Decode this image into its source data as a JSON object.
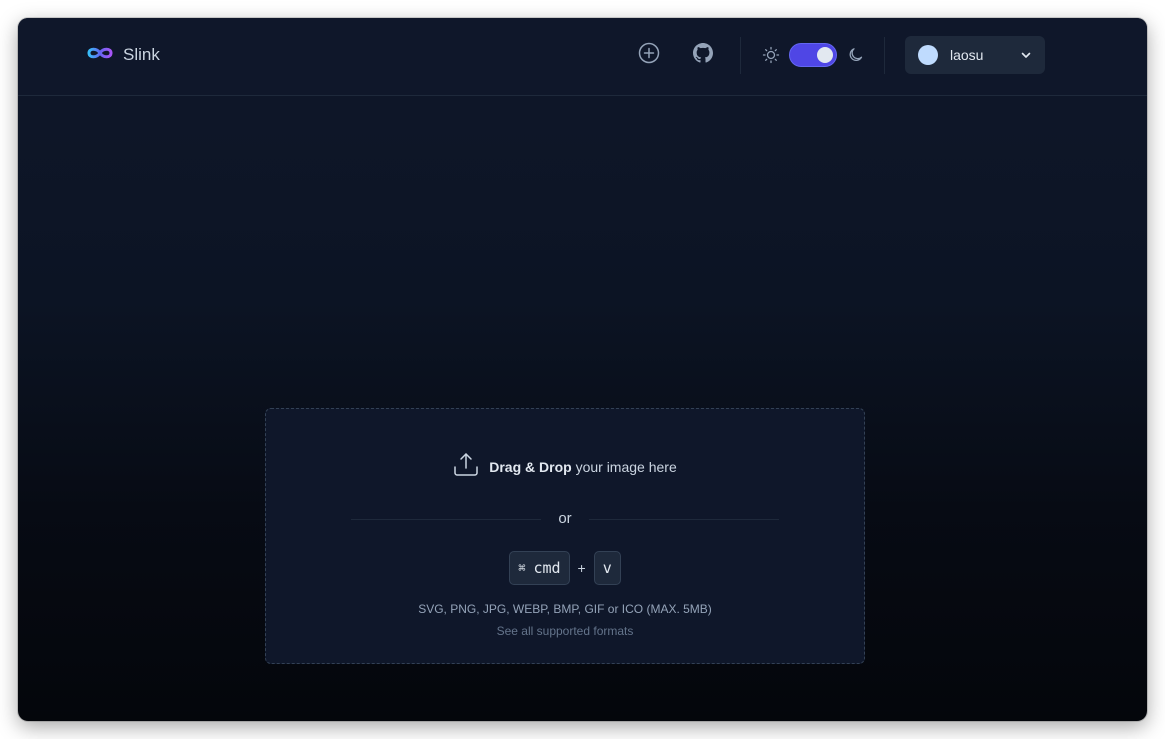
{
  "header": {
    "app_name": "Slink",
    "user": {
      "name": "laosu"
    }
  },
  "icons": {
    "logo": "infinity-logo-icon",
    "upload_new": "plus-circle-icon",
    "github": "github-icon",
    "light_mode": "sun-icon",
    "dark_mode": "moon-icon",
    "user_menu": "chevron-down-icon",
    "upload": "upload-icon"
  },
  "theme_toggle": {
    "dark_enabled": true
  },
  "dropzone": {
    "title_bold": "Drag & Drop",
    "title_rest": " your image here",
    "or_text": "or",
    "key_symbol": "⌘",
    "key_mod": "cmd",
    "plus": "+",
    "key_letter": "v",
    "formats": "SVG, PNG, JPG, WEBP, BMP, GIF or ICO (MAX. 5MB)",
    "see_all": "See all supported formats"
  },
  "colors": {
    "accent": "#4f46e5",
    "background": "#0f172a"
  }
}
